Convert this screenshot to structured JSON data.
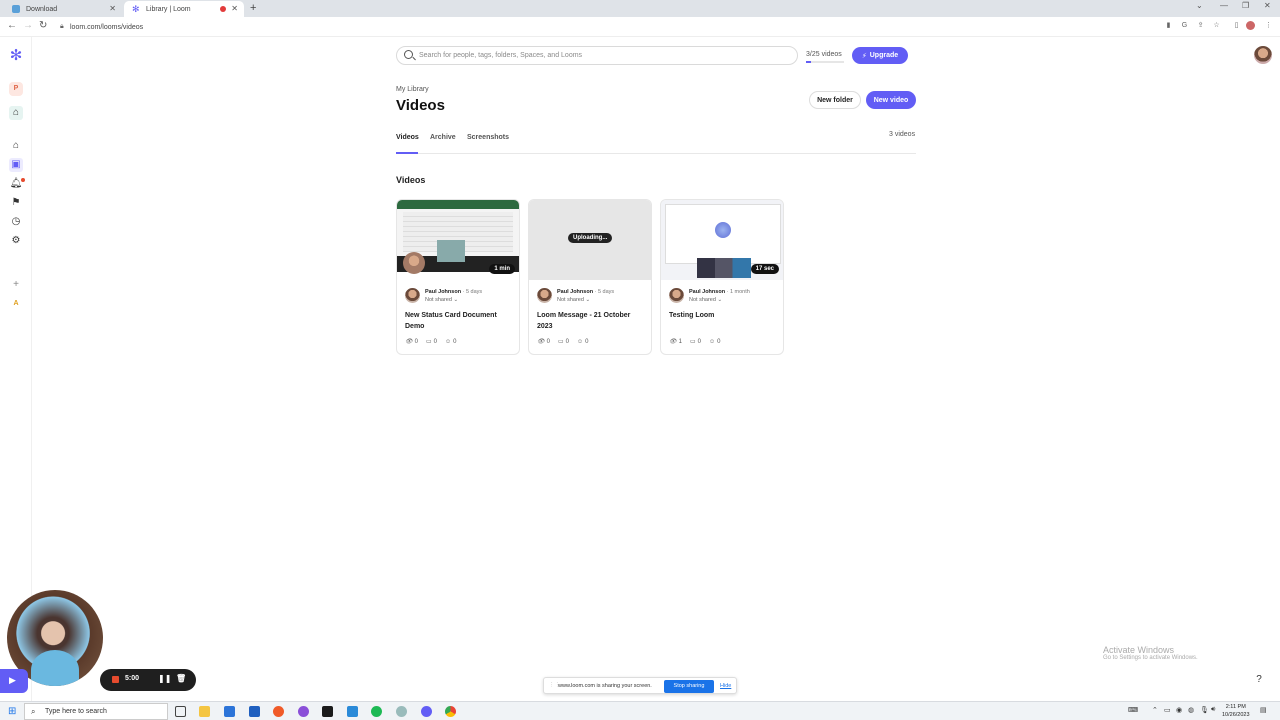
{
  "browser": {
    "tabs": [
      {
        "label": "Download",
        "active": false
      },
      {
        "label": "Library | Loom",
        "active": true
      }
    ],
    "url": "loom.com/looms/videos"
  },
  "header": {
    "search_placeholder": "Search for people, tags, folders, Spaces, and Looms",
    "video_usage": "3/25 videos",
    "video_usage_fraction": 0.12,
    "upgrade_label": "Upgrade"
  },
  "page": {
    "breadcrumb": "My Library",
    "title": "Videos",
    "new_folder_label": "New folder",
    "new_video_label": "New video",
    "tabs": [
      "Videos",
      "Archive",
      "Screenshots"
    ],
    "count": "3 videos",
    "section_title": "Videos"
  },
  "cards": [
    {
      "author": "Paul Johnson",
      "age": "· 5 days",
      "sharing": "Not shared",
      "title": "New Status Card Document Demo",
      "duration": "1 min",
      "views": "0",
      "comments": "0",
      "reactions": "0"
    },
    {
      "author": "Paul Johnson",
      "age": "· 5 days",
      "sharing": "Not shared",
      "title": "Loom Message - 21 October 2023",
      "status": "Uploading...",
      "views": "0",
      "comments": "0",
      "reactions": "0"
    },
    {
      "author": "Paul Johnson",
      "age": "· 1 month",
      "sharing": "Not shared",
      "title": "Testing Loom",
      "duration": "17 sec",
      "views": "1",
      "comments": "0",
      "reactions": "0"
    }
  ],
  "recorder": {
    "time": "5:00"
  },
  "share_bar": {
    "message": "www.loom.com is sharing your screen.",
    "stop_label": "Stop sharing",
    "hide_label": "Hide"
  },
  "watermark": {
    "line1": "Activate Windows",
    "line2": "Go to Settings to activate Windows."
  },
  "taskbar": {
    "search_placeholder": "Type here to search",
    "time": "2:11 PM",
    "date": "10/26/2023"
  },
  "colors": {
    "accent": "#625df5",
    "record": "#e64b2e"
  }
}
